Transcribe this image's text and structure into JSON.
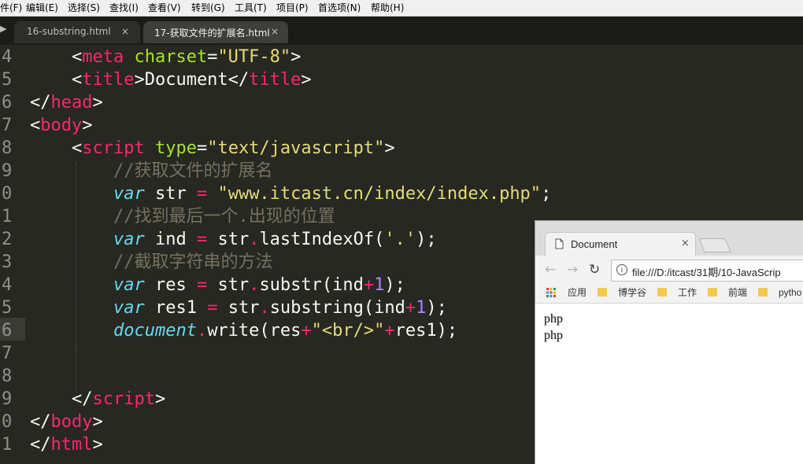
{
  "menu": [
    "件(F)",
    "编辑(E)",
    "选择(S)",
    "查找(I)",
    "查看(V)",
    "转到(G)",
    "工具(T)",
    "项目(P)",
    "首选项(N)",
    "帮助(H)"
  ],
  "tabs": [
    {
      "label": "16-substring.html",
      "active": false
    },
    {
      "label": "17-获取文件的扩展名.html",
      "active": true
    }
  ],
  "tab_close_glyph": "×",
  "line_numbers": [
    "4",
    "5",
    "6",
    "7",
    "8",
    "9",
    "0",
    "1",
    "2",
    "3",
    "4",
    "5",
    "6",
    "7",
    "8",
    "9",
    "0",
    "1"
  ],
  "code_lines": [
    [
      [
        "txt",
        "    <"
      ],
      [
        "tg",
        "meta"
      ],
      [
        "txt",
        " "
      ],
      [
        "at",
        "charset"
      ],
      [
        "txt",
        "="
      ],
      [
        "st",
        "\"UTF-8\""
      ],
      [
        "txt",
        ">"
      ]
    ],
    [
      [
        "txt",
        "    <"
      ],
      [
        "tg",
        "title"
      ],
      [
        "txt",
        ">Document</"
      ],
      [
        "tg",
        "title"
      ],
      [
        "txt",
        ">"
      ]
    ],
    [
      [
        "txt",
        "</"
      ],
      [
        "tg",
        "head"
      ],
      [
        "txt",
        ">"
      ]
    ],
    [
      [
        "txt",
        "<"
      ],
      [
        "tg",
        "body"
      ],
      [
        "txt",
        ">"
      ]
    ],
    [
      [
        "txt",
        "    <"
      ],
      [
        "tg",
        "script"
      ],
      [
        "txt",
        " "
      ],
      [
        "at",
        "type"
      ],
      [
        "txt",
        "="
      ],
      [
        "st",
        "\"text/javascript\""
      ],
      [
        "txt",
        ">"
      ]
    ],
    [
      [
        "txt",
        "        "
      ],
      [
        "cm",
        "//获取文件的扩展名"
      ]
    ],
    [
      [
        "txt",
        "        "
      ],
      [
        "kw",
        "var"
      ],
      [
        "txt",
        " str "
      ],
      [
        "op",
        "="
      ],
      [
        "txt",
        " "
      ],
      [
        "st",
        "\"www.itcast.cn/index/index.php\""
      ],
      [
        "txt",
        ";"
      ]
    ],
    [
      [
        "txt",
        "        "
      ],
      [
        "cm",
        "//找到最后一个.出现的位置"
      ]
    ],
    [
      [
        "txt",
        "        "
      ],
      [
        "kw",
        "var"
      ],
      [
        "txt",
        " ind "
      ],
      [
        "op",
        "="
      ],
      [
        "txt",
        " str"
      ],
      [
        "op",
        "."
      ],
      [
        "txt",
        "lastIndexOf("
      ],
      [
        "st",
        "'.'"
      ],
      [
        "txt",
        ");"
      ]
    ],
    [
      [
        "txt",
        "        "
      ],
      [
        "cm",
        "//截取字符串的方法"
      ]
    ],
    [
      [
        "txt",
        "        "
      ],
      [
        "kw",
        "var"
      ],
      [
        "txt",
        " res "
      ],
      [
        "op",
        "="
      ],
      [
        "txt",
        " str"
      ],
      [
        "op",
        "."
      ],
      [
        "txt",
        "substr(ind"
      ],
      [
        "op",
        "+"
      ],
      [
        "nm",
        "1"
      ],
      [
        "txt",
        ");"
      ]
    ],
    [
      [
        "txt",
        "        "
      ],
      [
        "kw",
        "var"
      ],
      [
        "txt",
        " res1 "
      ],
      [
        "op",
        "="
      ],
      [
        "txt",
        " str"
      ],
      [
        "op",
        "."
      ],
      [
        "txt",
        "substring(ind"
      ],
      [
        "op",
        "+"
      ],
      [
        "nm",
        "1"
      ],
      [
        "txt",
        ");"
      ]
    ],
    [
      [
        "txt",
        "        "
      ],
      [
        "kw",
        "document"
      ],
      [
        "op",
        "."
      ],
      [
        "txt",
        "write(res"
      ],
      [
        "op",
        "+"
      ],
      [
        "st",
        "\"<br/>\""
      ],
      [
        "op",
        "+"
      ],
      [
        "txt",
        "res1);"
      ]
    ],
    [],
    [],
    [
      [
        "txt",
        "    </"
      ],
      [
        "tg",
        "script"
      ],
      [
        "txt",
        ">"
      ]
    ],
    [
      [
        "txt",
        "</"
      ],
      [
        "tg",
        "body"
      ],
      [
        "txt",
        ">"
      ]
    ],
    [
      [
        "txt",
        "</"
      ],
      [
        "tg",
        "html"
      ],
      [
        "txt",
        ">"
      ]
    ]
  ],
  "current_line_index": 12,
  "browser": {
    "tab_title": "Document",
    "close_glyph": "×",
    "back_glyph": "←",
    "forward_glyph": "→",
    "reload_glyph": "↻",
    "info_glyph": "i",
    "url": "file:///D:/itcast/31期/10-JavaScrip",
    "apps_label": "应用",
    "bookmarks": [
      "博学谷",
      "工作",
      "前端",
      "pytho"
    ],
    "output_lines": [
      "php",
      "php"
    ]
  }
}
